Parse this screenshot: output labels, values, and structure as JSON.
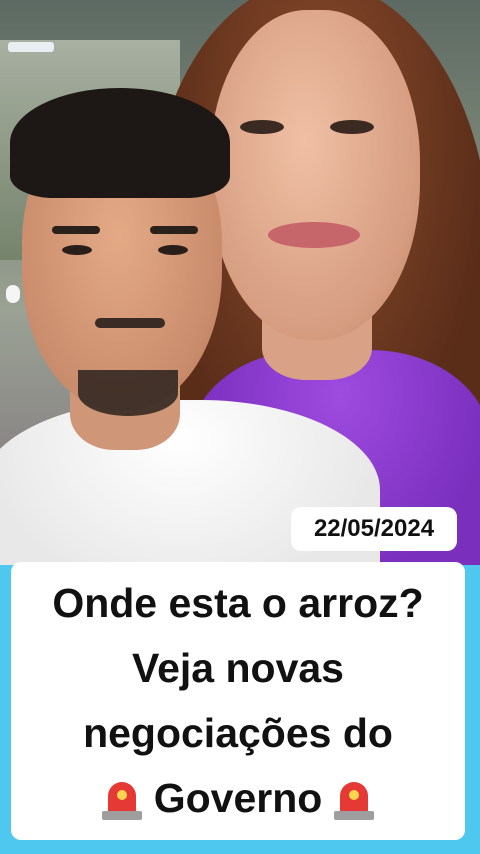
{
  "video": {
    "date_badge": "22/05/2024"
  },
  "caption": {
    "lines": [
      "Onde esta o arroz?",
      "Veja novas",
      "negociações do"
    ],
    "last_line_word": "Governo",
    "icons": [
      "siren-icon",
      "siren-icon"
    ]
  },
  "colors": {
    "background": "#4fc8ef",
    "card": "#ffffff",
    "text": "#111111",
    "siren": "#e53935"
  }
}
